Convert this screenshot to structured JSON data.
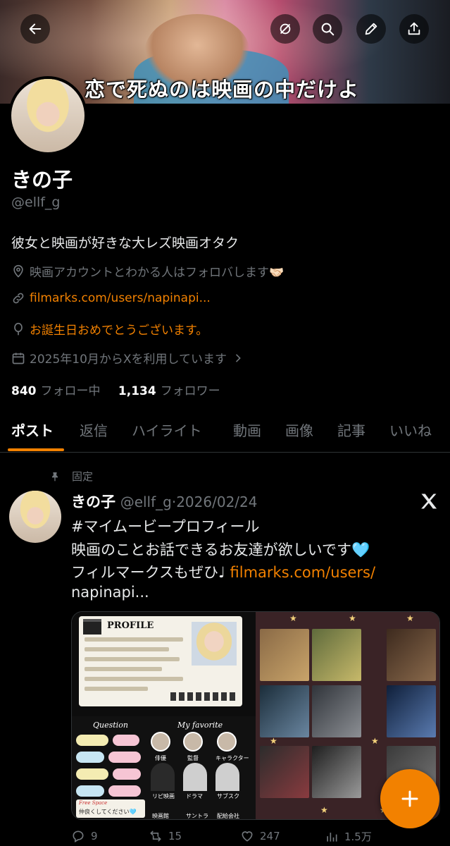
{
  "banner": {
    "caption": "恋で死ぬのは映画の中だけよ"
  },
  "header_buttons": [
    "back-arrow-icon",
    "grok-icon",
    "search-icon",
    "edit-icon",
    "share-icon"
  ],
  "profile": {
    "name": "きの子",
    "handle": "@ellf_g",
    "bio": "彼女と映画が好きな大レズ映画オタク",
    "location": "映画アカウントとわかる人はフォロバします🤝🏻",
    "website": "filmarks.com/users/napinapi...",
    "birthday": "お誕生日おめでとうございます。",
    "joined": "2025年10月からXを利用しています",
    "following_count": "840",
    "following_label": "フォロー中",
    "followers_count": "1,134",
    "followers_label": "フォロワー"
  },
  "tabs": [
    "ポスト",
    "返信",
    "ハイライト",
    "動画",
    "画像",
    "記事",
    "いいね"
  ],
  "active_tab": 0,
  "post": {
    "pinned_label": "固定",
    "name": "きの子",
    "handle": "@ellf_g",
    "separator": "·",
    "date": "2026/02/24",
    "hashtag": "#マイムービープロフィール",
    "line1": "映画のことお話できるお友達が欲しいです🩵",
    "line2_text": "フィルマークスもぜひ♩ ",
    "line2_link": "filmarks.com/users/",
    "line3_link": "napinapi...",
    "media_left": {
      "title": "PROFILE",
      "question_title": "Question",
      "favorite_title": "My favorite",
      "labels": [
        "俳優",
        "監督",
        "キャラクター",
        "リピ映画",
        "ドラマ",
        "サブスク",
        "映画館",
        "サントラ",
        "配給会社"
      ],
      "free_space_title": "Free Space",
      "free_space_text": "仲良くしてください🩵"
    },
    "actions": [
      {
        "icon": "reply-icon",
        "count": "9"
      },
      {
        "icon": "repost-icon",
        "count": "15"
      },
      {
        "icon": "like-icon",
        "count": "247"
      },
      {
        "icon": "views-icon",
        "count": "1.5万"
      }
    ]
  },
  "colors": {
    "accent": "#f28100",
    "muted": "#71767b",
    "text": "#e7e9ea",
    "bg": "#000000"
  }
}
